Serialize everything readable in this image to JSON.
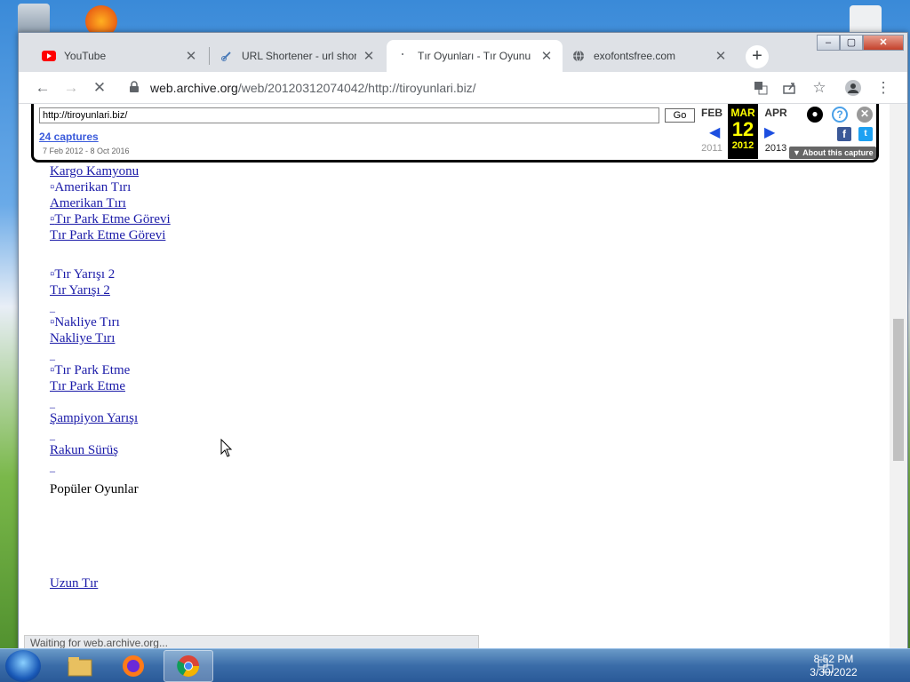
{
  "browser": {
    "tabs": [
      {
        "title": "YouTube",
        "icon": "youtube-icon",
        "active": false
      },
      {
        "title": "URL Shortener - url short",
        "icon": "link-icon",
        "active": false
      },
      {
        "title": "Tır Oyunları - Tır Oyunu C",
        "icon": "page-icon",
        "active": true
      },
      {
        "title": "exofontsfree.com",
        "icon": "globe-icon",
        "active": false
      }
    ],
    "new_tab": "+",
    "url_host": "web.archive.org",
    "url_path": "/web/20120312074042/http://tiroyunlari.biz/",
    "status": "Waiting for web.archive.org..."
  },
  "wayback": {
    "url_value": "http://tiroyunlari.biz/",
    "go_label": "Go",
    "captures": "24 captures",
    "range": "7 Feb 2012 - 8 Oct 2016",
    "prev_month": "FEB",
    "prev_year": "2011",
    "cur_month": "MAR",
    "cur_day": "12",
    "cur_year": "2012",
    "next_month": "APR",
    "next_year": "2013",
    "about": "About this capture"
  },
  "page": {
    "items": [
      {
        "alt": "",
        "link": "Kargo Kamyonu"
      },
      {
        "alt": "Amerikan Tırı",
        "link": "Amerikan Tırı"
      },
      {
        "alt": "Tır Park Etme Görevi",
        "link": "Tır Park Etme Görevi"
      },
      {
        "alt": "Tır Yarışı 2",
        "link": "Tır Yarışı 2"
      },
      {
        "alt": "Nakliye Tırı",
        "link": "Nakliye Tırı"
      },
      {
        "alt": "Tır Park Etme",
        "link": "Tır Park Etme"
      },
      {
        "alt": "",
        "link": "Şampiyon Yarışı"
      },
      {
        "alt": "",
        "link": "Rakun Sürüş"
      }
    ],
    "popular_heading": "Popüler Oyunlar",
    "uzun_tir": "Uzun Tır"
  },
  "taskbar": {
    "time": "8:52 PM",
    "date": "3/30/2022"
  },
  "colors": {
    "link": "#1a1aa8",
    "wayback_accent": "#ffff00",
    "chrome_tabstrip": "#dee1e6"
  }
}
